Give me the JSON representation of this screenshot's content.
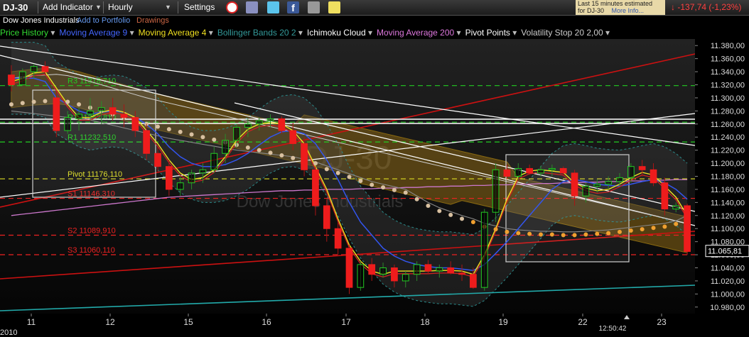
{
  "toolbar": {
    "symbol": "DJ-30",
    "add_indicator": "Add Indicator",
    "interval": "Hourly",
    "settings": "Settings",
    "notice_line1": "Last 15 minutes estimated",
    "notice_line2": "for DJ-30",
    "more_info": "More Info...",
    "change": "-137,74 (-1,23%)"
  },
  "subbar": {
    "name": "Dow Jones Industrials",
    "add_portfolio": "Add to Portfolio",
    "drawings": "Drawings"
  },
  "legend": [
    {
      "label": "Price History",
      "color": "#33dd33"
    },
    {
      "label": "Moving Average 9",
      "color": "#4466ff"
    },
    {
      "label": "Moving Average 4",
      "color": "#f0e020"
    },
    {
      "label": "Bollinger Bands 20 2",
      "color": "#339999"
    },
    {
      "label": "Ichimoku Cloud",
      "color": "#ffffff"
    },
    {
      "label": "Moving Average 200",
      "color": "#dd77dd"
    },
    {
      "label": "Pivot Points",
      "color": "#ffffff"
    },
    {
      "label": "Volatility Stop 20 2,00",
      "color": "#cccccc"
    }
  ],
  "chart_data": {
    "type": "candlestick",
    "watermark_title": "DJ-30",
    "watermark_sub": "Dow Jones Industrials",
    "yaxis": {
      "min": 10970,
      "max": 11390,
      "ticks": [
        "11.380,00",
        "11.360,00",
        "11.340,00",
        "11.320,00",
        "11.300,00",
        "11.280,00",
        "11.260,00",
        "11.240,00",
        "11.220,00",
        "11.200,00",
        "11.180,00",
        "11.160,00",
        "11.140,00",
        "11.120,00",
        "11.100,00",
        "11.080,00",
        "11.060,00",
        "11.040,00",
        "11.020,00",
        "11.000,00",
        "10.980,00"
      ]
    },
    "xaxis": {
      "labels": [
        "11",
        "12",
        "15",
        "16",
        "17",
        "18",
        "19",
        "22",
        "23"
      ],
      "year_label": "2010",
      "time_label": "12:50:42"
    },
    "last_price": "11.065,81",
    "pivots": [
      {
        "name": "R3",
        "label": "R3 11318,710",
        "value": 11318.71,
        "color": "#22cc22"
      },
      {
        "name": "R2",
        "label": "R2 11262,810",
        "value": 11262.81,
        "color": "#22cc22"
      },
      {
        "name": "R1",
        "label": "R1 11232,510",
        "value": 11232.51,
        "color": "#22cc22"
      },
      {
        "name": "Pivot",
        "label": "Pivot 11176,110",
        "value": 11176.11,
        "color": "#dddd22"
      },
      {
        "name": "S1",
        "label": "S1 11146,310",
        "value": 11146.31,
        "color": "#ee2222"
      },
      {
        "name": "S2",
        "label": "S2 11089,910",
        "value": 11089.91,
        "color": "#ee2222"
      },
      {
        "name": "S3",
        "label": "S3 11060,110",
        "value": 11060.11,
        "color": "#ee2222"
      }
    ],
    "candles": [
      [
        11335,
        11350,
        11310,
        11320
      ],
      [
        11320,
        11345,
        11318,
        11340
      ],
      [
        11340,
        11352,
        11330,
        11348
      ],
      [
        11348,
        11356,
        11335,
        11340
      ],
      [
        11300,
        11310,
        11240,
        11250
      ],
      [
        11250,
        11280,
        11245,
        11270
      ],
      [
        11268,
        11285,
        11250,
        11275
      ],
      [
        11275,
        11300,
        11265,
        11280
      ],
      [
        11280,
        11295,
        11260,
        11285
      ],
      [
        11285,
        11300,
        11265,
        11275
      ],
      [
        11275,
        11290,
        11255,
        11270
      ],
      [
        11270,
        11280,
        11240,
        11250
      ],
      [
        11250,
        11260,
        11205,
        11215
      ],
      [
        11215,
        11225,
        11185,
        11195
      ],
      [
        11195,
        11205,
        11150,
        11160
      ],
      [
        11160,
        11180,
        11150,
        11170
      ],
      [
        11170,
        11190,
        11160,
        11185
      ],
      [
        11185,
        11200,
        11170,
        11190
      ],
      [
        11190,
        11225,
        11185,
        11215
      ],
      [
        11215,
        11245,
        11200,
        11235
      ],
      [
        11235,
        11260,
        11225,
        11255
      ],
      [
        11255,
        11268,
        11240,
        11260
      ],
      [
        11260,
        11270,
        11250,
        11265
      ],
      [
        11265,
        11275,
        11255,
        11268
      ],
      [
        11268,
        11272,
        11245,
        11250
      ],
      [
        11250,
        11262,
        11220,
        11230
      ],
      [
        11230,
        11240,
        11180,
        11190
      ],
      [
        11190,
        11195,
        11120,
        11135
      ],
      [
        11135,
        11145,
        11080,
        11100
      ],
      [
        11100,
        11110,
        11060,
        11070
      ],
      [
        11070,
        11075,
        11000,
        11010
      ],
      [
        11010,
        11050,
        11005,
        11045
      ],
      [
        11045,
        11055,
        11020,
        11030
      ],
      [
        11030,
        11048,
        11025,
        11040
      ],
      [
        11040,
        11045,
        11010,
        11020
      ],
      [
        11020,
        11035,
        11010,
        11030
      ],
      [
        11030,
        11050,
        11020,
        11045
      ],
      [
        11045,
        11052,
        11030,
        11035
      ],
      [
        11035,
        11045,
        11025,
        11040
      ],
      [
        11040,
        11050,
        11030,
        11032
      ],
      [
        11032,
        11045,
        11020,
        11030
      ],
      [
        11030,
        11040,
        11008,
        11010
      ],
      [
        11010,
        11130,
        11005,
        11125
      ],
      [
        11125,
        11200,
        11110,
        11190
      ],
      [
        11190,
        11198,
        11175,
        11180
      ],
      [
        11180,
        11200,
        11175,
        11192
      ],
      [
        11192,
        11198,
        11182,
        11185
      ],
      [
        11185,
        11196,
        11180,
        11190
      ],
      [
        11190,
        11198,
        11180,
        11192
      ],
      [
        11192,
        11195,
        11180,
        11185
      ],
      [
        11185,
        11190,
        11135,
        11150
      ],
      [
        11150,
        11170,
        11140,
        11165
      ],
      [
        11165,
        11175,
        11155,
        11168
      ],
      [
        11168,
        11180,
        11160,
        11172
      ],
      [
        11172,
        11185,
        11165,
        11178
      ],
      [
        11178,
        11200,
        11170,
        11195
      ],
      [
        11195,
        11205,
        11180,
        11190
      ],
      [
        11190,
        11200,
        11165,
        11170
      ],
      [
        11170,
        11178,
        11120,
        11130
      ],
      [
        11130,
        11140,
        11125,
        11135
      ],
      [
        11135,
        11138,
        11060,
        11065
      ]
    ],
    "ma9": [
      11330,
      11330,
      11330,
      11325,
      11300,
      11290,
      11280,
      11275,
      11278,
      11280,
      11278,
      11270,
      11260,
      11245,
      11225,
      11210,
      11200,
      11195,
      11195,
      11198,
      11205,
      11215,
      11228,
      11240,
      11248,
      11250,
      11245,
      11230,
      11205,
      11175,
      11140,
      11110,
      11090,
      11070,
      11058,
      11050,
      11045,
      11042,
      11040,
      11040,
      11038,
      11036,
      11045,
      11062,
      11080,
      11100,
      11120,
      11140,
      11160,
      11172,
      11175,
      11172,
      11168,
      11166,
      11165,
      11168,
      11172,
      11175,
      11170,
      11160,
      11145
    ],
    "ma4": [
      11325,
      11330,
      11338,
      11340,
      11315,
      11290,
      11270,
      11270,
      11278,
      11282,
      11278,
      11270,
      11250,
      11230,
      11205,
      11185,
      11175,
      11178,
      11190,
      11210,
      11235,
      11252,
      11260,
      11262,
      11260,
      11250,
      11230,
      11195,
      11160,
      11115,
      11075,
      11050,
      11035,
      11030,
      11035,
      11035,
      11035,
      11035,
      11036,
      11036,
      11035,
      11030,
      11060,
      11100,
      11145,
      11180,
      11188,
      11190,
      11188,
      11186,
      11170,
      11162,
      11158,
      11160,
      11168,
      11178,
      11186,
      11182,
      11165,
      11148,
      11120
    ],
    "ma200": [
      11120,
      11122,
      11124,
      11126,
      11128,
      11130,
      11132,
      11134,
      11136,
      11138,
      11140,
      11142,
      11144,
      11146,
      11148,
      11149,
      11150,
      11151,
      11152,
      11153,
      11154,
      11155,
      11156,
      11157,
      11158,
      11158,
      11159,
      11159,
      11160,
      11160,
      11160,
      11161,
      11161,
      11162,
      11162,
      11163,
      11163,
      11164,
      11164,
      11165,
      11165,
      11166,
      11166,
      11167,
      11167,
      11168,
      11168,
      11169,
      11169,
      11170,
      11170,
      11171,
      11171,
      11172,
      11172,
      11173,
      11173,
      11174,
      11174,
      11175,
      11175
    ],
    "vstop": [
      11280,
      11278,
      11276,
      11274,
      11272,
      11270,
      11268,
      11266,
      11262,
      11258,
      11254,
      11250,
      11246,
      11242,
      11238,
      11235,
      11232,
      11229,
      11226,
      11223,
      11220,
      11218,
      11216,
      11214,
      11212,
      11210,
      11206,
      11202,
      11196,
      11190,
      11184,
      11178,
      11172,
      11168,
      11164,
      11160,
      11150,
      11140,
      11132,
      11126,
      11120,
      11115,
      11108,
      11104,
      11100,
      11098,
      11097,
      11096,
      11096,
      11095,
      11095,
      11096,
      11097,
      11098,
      11100,
      11102,
      11104,
      11106,
      11108,
      11112,
      11120
    ],
    "vstop_green": [
      11330,
      11332,
      11334,
      11335,
      11336,
      11334,
      11330,
      11325,
      11320,
      11315,
      11310,
      11305,
      11300,
      11296,
      11292,
      11288,
      11284,
      11280,
      11276,
      11272,
      11268,
      11264,
      11260,
      11256,
      11252,
      11248,
      11244,
      11240,
      11236,
      11232,
      11228,
      11224,
      11220,
      11216,
      11212,
      11208,
      11204,
      11200,
      11196,
      11192,
      11188,
      11184,
      11180,
      11176,
      11172,
      11168,
      11164,
      11160,
      11156,
      11152,
      11148,
      11144,
      11140,
      11136,
      11132,
      11128,
      11124,
      11120,
      11116,
      11112,
      11108
    ]
  }
}
